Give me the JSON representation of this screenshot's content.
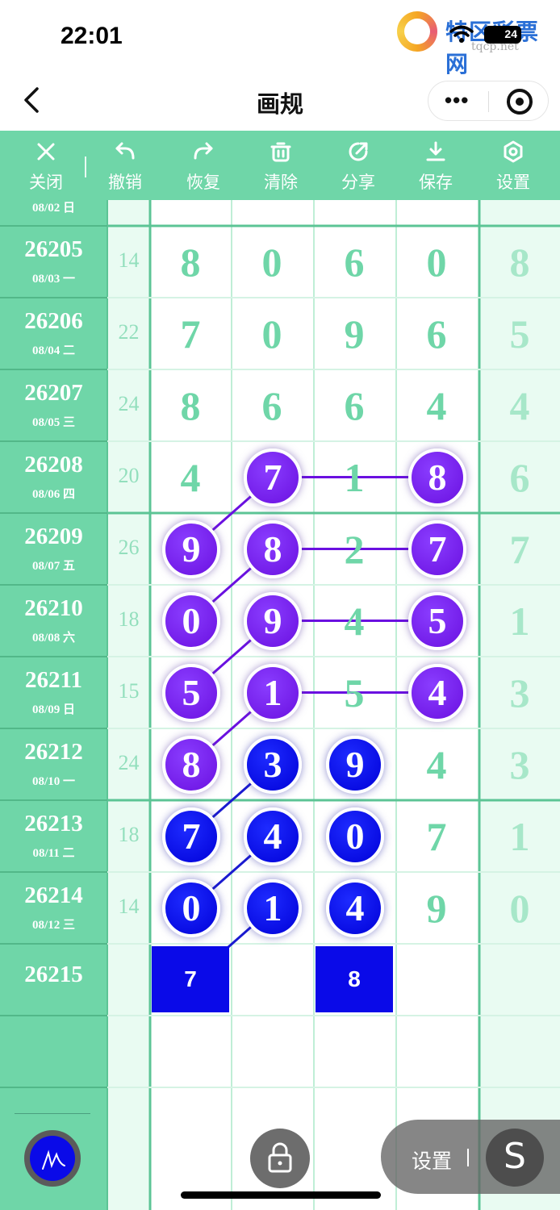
{
  "status_bar": {
    "time": "22:01",
    "battery": "24"
  },
  "watermark": {
    "brand": "特区彩票网",
    "domain": "tqcp.net"
  },
  "nav": {
    "title": "画规"
  },
  "toolbar": [
    {
      "id": "close",
      "label": "关闭",
      "icon": "close-icon"
    },
    {
      "id": "undo",
      "label": "撤销",
      "icon": "undo-icon"
    },
    {
      "id": "redo",
      "label": "恢复",
      "icon": "redo-icon"
    },
    {
      "id": "clear",
      "label": "清除",
      "icon": "trash-icon"
    },
    {
      "id": "share",
      "label": "分享",
      "icon": "share-icon"
    },
    {
      "id": "save",
      "label": "保存",
      "icon": "download-icon"
    },
    {
      "id": "settings",
      "label": "设置",
      "icon": "gear-icon"
    }
  ],
  "partial_row": {
    "date": "08/02 日"
  },
  "rows": [
    {
      "period": "26205",
      "date": "08/03 一",
      "sum": "14",
      "digits": [
        "8",
        "0",
        "6",
        "0"
      ],
      "extra": "8"
    },
    {
      "period": "26206",
      "date": "08/04 二",
      "sum": "22",
      "digits": [
        "7",
        "0",
        "9",
        "6"
      ],
      "extra": "5"
    },
    {
      "period": "26207",
      "date": "08/05 三",
      "sum": "24",
      "digits": [
        "8",
        "6",
        "6",
        "4"
      ],
      "extra": "4"
    },
    {
      "period": "26208",
      "date": "08/06 四",
      "sum": "20",
      "digits": [
        "4",
        "7",
        "1",
        "8"
      ],
      "extra": "6"
    },
    {
      "period": "26209",
      "date": "08/07 五",
      "sum": "26",
      "digits": [
        "9",
        "8",
        "2",
        "7"
      ],
      "extra": "7"
    },
    {
      "period": "26210",
      "date": "08/08 六",
      "sum": "18",
      "digits": [
        "0",
        "9",
        "4",
        "5"
      ],
      "extra": "1"
    },
    {
      "period": "26211",
      "date": "08/09 日",
      "sum": "15",
      "digits": [
        "5",
        "1",
        "5",
        "4"
      ],
      "extra": "3"
    },
    {
      "period": "26212",
      "date": "08/10 一",
      "sum": "24",
      "digits": [
        "8",
        "3",
        "9",
        "4"
      ],
      "extra": "3"
    },
    {
      "period": "26213",
      "date": "08/11 二",
      "sum": "18",
      "digits": [
        "7",
        "4",
        "0",
        "7"
      ],
      "extra": "1"
    },
    {
      "period": "26214",
      "date": "08/12 三",
      "sum": "14",
      "digits": [
        "0",
        "1",
        "4",
        "9"
      ],
      "extra": "0"
    },
    {
      "period": "26215",
      "date": "",
      "sum": "",
      "digits": [
        "",
        "",
        "",
        ""
      ],
      "extra": ""
    }
  ],
  "highlights": [
    {
      "row": 3,
      "col": 1,
      "color": "purple"
    },
    {
      "row": 3,
      "col": 3,
      "color": "purple"
    },
    {
      "row": 4,
      "col": 0,
      "color": "purple"
    },
    {
      "row": 4,
      "col": 1,
      "color": "purple"
    },
    {
      "row": 4,
      "col": 3,
      "color": "purple"
    },
    {
      "row": 5,
      "col": 0,
      "color": "purple"
    },
    {
      "row": 5,
      "col": 1,
      "color": "purple"
    },
    {
      "row": 5,
      "col": 3,
      "color": "purple"
    },
    {
      "row": 6,
      "col": 0,
      "color": "purple"
    },
    {
      "row": 6,
      "col": 1,
      "color": "purple"
    },
    {
      "row": 6,
      "col": 3,
      "color": "purple"
    },
    {
      "row": 7,
      "col": 0,
      "color": "purple"
    },
    {
      "row": 7,
      "col": 1,
      "color": "blue"
    },
    {
      "row": 7,
      "col": 2,
      "color": "blue"
    },
    {
      "row": 8,
      "col": 0,
      "color": "blue"
    },
    {
      "row": 8,
      "col": 1,
      "color": "blue"
    },
    {
      "row": 8,
      "col": 2,
      "color": "blue"
    },
    {
      "row": 9,
      "col": 0,
      "color": "blue"
    },
    {
      "row": 9,
      "col": 1,
      "color": "blue"
    },
    {
      "row": 9,
      "col": 2,
      "color": "blue"
    }
  ],
  "connectors": [
    {
      "from": [
        3,
        1
      ],
      "to": [
        3,
        3
      ],
      "color": "#6a10e0"
    },
    {
      "from": [
        4,
        1
      ],
      "to": [
        4,
        3
      ],
      "color": "#6a10e0"
    },
    {
      "from": [
        5,
        1
      ],
      "to": [
        5,
        3
      ],
      "color": "#6a10e0"
    },
    {
      "from": [
        6,
        1
      ],
      "to": [
        6,
        3
      ],
      "color": "#6a10e0"
    },
    {
      "from": [
        4,
        0
      ],
      "to": [
        3,
        1
      ],
      "color": "#6a10e0"
    },
    {
      "from": [
        5,
        0
      ],
      "to": [
        4,
        1
      ],
      "color": "#6a10e0"
    },
    {
      "from": [
        6,
        0
      ],
      "to": [
        5,
        1
      ],
      "color": "#6a10e0"
    },
    {
      "from": [
        7,
        0
      ],
      "to": [
        6,
        1
      ],
      "color": "#6a10e0"
    },
    {
      "from": [
        8,
        0
      ],
      "to": [
        7,
        1
      ],
      "color": "#1a1ad0"
    },
    {
      "from": [
        9,
        0
      ],
      "to": [
        8,
        1
      ],
      "color": "#1a1ad0"
    },
    {
      "from": [
        10,
        0
      ],
      "to": [
        9,
        1
      ],
      "color": "#1a1ad0"
    }
  ],
  "prediction": [
    {
      "col": 0,
      "value": "7"
    },
    {
      "col": 2,
      "value": "8"
    }
  ],
  "bottom": {
    "settings_label": "设置",
    "s_glyph": "S"
  },
  "colors": {
    "accent": "#6fd6a8",
    "purple": "#6a10e0",
    "blue": "#0000d8"
  }
}
